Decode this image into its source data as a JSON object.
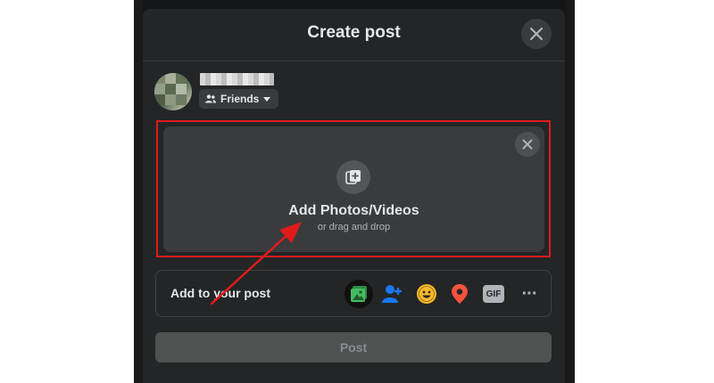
{
  "modal": {
    "title": "Create post"
  },
  "composer": {
    "username": "                         ",
    "audience_label": "Friends"
  },
  "upload": {
    "title": "Add Photos/Videos",
    "subtitle": "or drag and drop"
  },
  "add_to_post": {
    "label": "Add to your post",
    "icons": [
      "photo-video-icon",
      "tag-people-icon",
      "feeling-icon",
      "check-in-icon",
      "gif-icon",
      "more-icon"
    ],
    "gif_text": "GIF",
    "more_text": "···"
  },
  "post_button": {
    "label": "Post"
  },
  "colors": {
    "modal_bg": "#242526",
    "highlight_border": "#e01b1b",
    "annotation_arrow": "#e01b1b",
    "photo_icon": "#45bd62",
    "tag_icon": "#1877f2",
    "feeling_icon": "#f7b928",
    "location_icon": "#f5533d"
  }
}
